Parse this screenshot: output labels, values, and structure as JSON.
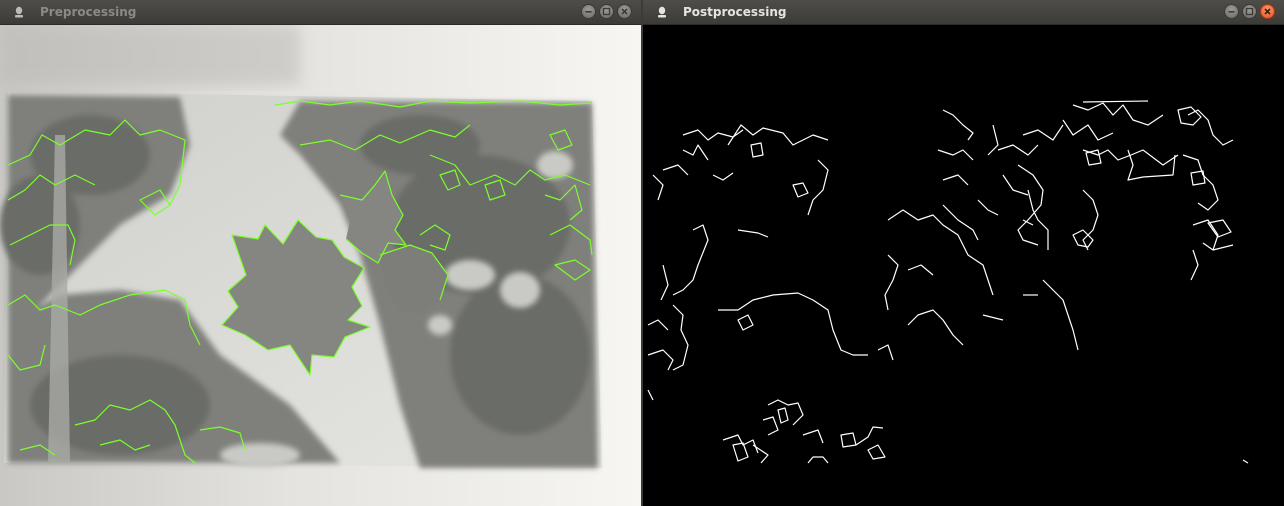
{
  "windows": {
    "pre": {
      "title": "Preprocessing",
      "icon": "app-icon",
      "active": false
    },
    "post": {
      "title": "Postprocessing",
      "icon": "app-icon",
      "active": true
    }
  },
  "controls": [
    "minimize-button",
    "maximize-button",
    "close-button"
  ],
  "colors": {
    "titlebar": "#3c3b37",
    "contour": "#7cff2a",
    "edges": "#ffffff",
    "post_background": "#000000",
    "close_active": "#e0541f"
  }
}
